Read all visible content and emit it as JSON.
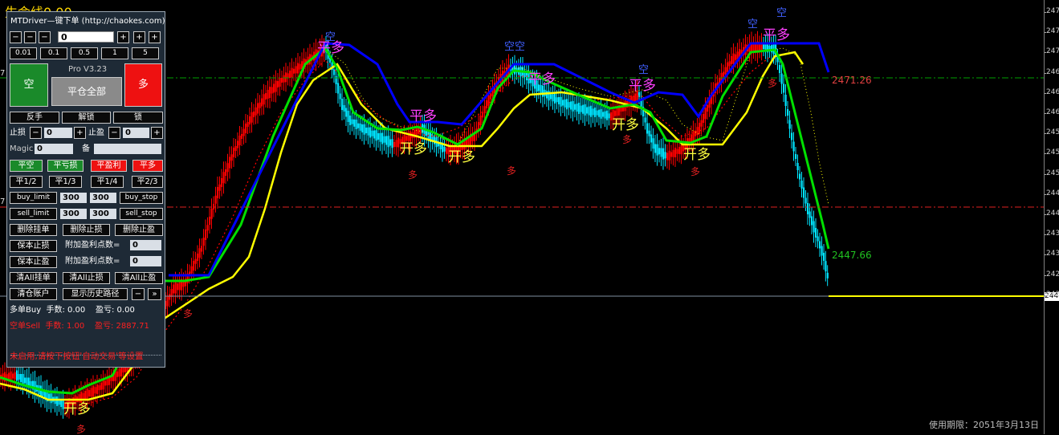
{
  "chart_header": {
    "title": "生命线0.00"
  },
  "price_axis": {
    "ticks": [
      "247",
      "247",
      "247",
      "246",
      "246",
      "246",
      "245",
      "245",
      "245",
      "244",
      "244",
      "243",
      "243",
      "242",
      "242"
    ],
    "current_price": "244"
  },
  "levels": {
    "upper_label": "2471.26",
    "lower_label": "2447.66",
    "left_marker_1": "7",
    "left_marker_2": "7"
  },
  "footer": {
    "expiry": "使用期限：2051年3月13日"
  },
  "signals": {
    "kong": "空",
    "kong_kong": "空空",
    "ping_duo": "平多",
    "kai_duo": "开多",
    "duo": "多"
  },
  "colors": {
    "bull_candle": "#ff0000",
    "bear_candle": "#00e5ff",
    "fast_line": "#00e000",
    "slow_line": "#ffff00",
    "stop_line": "#0000ff",
    "upper_level": "#00c000",
    "lower_level": "#ff2020"
  },
  "panel": {
    "title": "MTDriver—键下单 (http://chaokes.com)",
    "lot_value": "0",
    "minus_label": "−",
    "plus_label": "+",
    "lot_presets": [
      "0.01",
      "0.1",
      "0.5",
      "1",
      "5"
    ],
    "sell_button": "空",
    "buy_button": "多",
    "version": "Pro V3.23",
    "close_all": "平仓全部",
    "reverse": "反手",
    "unlock": "解锁",
    "lock": "锁",
    "stop_loss_label": "止损",
    "stop_loss_value": "0",
    "take_profit_label": "止盈",
    "take_profit_value": "0",
    "magic_label": "Magic",
    "magic_value": "0",
    "note_label": "备",
    "note_value": "",
    "close_short": "平空",
    "close_loss": "平亏损",
    "close_profit": "平盈利",
    "close_long": "平多",
    "close_half": "平1/2",
    "close_third": "平1/3",
    "close_quarter": "平1/4",
    "close_two_thirds": "平2/3",
    "buy_limit": "buy_limit",
    "buy_limit_val_1": "300",
    "buy_limit_val_2": "300",
    "buy_stop": "buy_stop",
    "sell_limit": "sell_limit",
    "sell_limit_val_1": "300",
    "sell_limit_val_2": "300",
    "sell_stop": "sell_stop",
    "delete_pending": "删除挂单",
    "delete_stop_loss": "删除止损",
    "delete_take_profit": "删除止盈",
    "breakeven_stop": "保本止损",
    "extra_points_label_1": "附加盈利点数=",
    "extra_points_value_1": "0",
    "breakeven_profit": "保本止盈",
    "extra_points_label_2": "附加盈利点数=",
    "extra_points_value_2": "0",
    "clear_all_pending": "清All挂单",
    "clear_all_sl": "清All止损",
    "clear_all_tp": "清All止盈",
    "close_account": "清仓账户",
    "show_history": "显示历史路径",
    "collapse_label": "−",
    "expand_label": "»",
    "long_summary": "多单Buy  手数: 0.00    盈亏: 0.00",
    "short_summary": "空单Sell  手数: 1.00    盈亏: 2887.71",
    "warning": "未启用,请按下按钮'自动交易'等设置"
  }
}
